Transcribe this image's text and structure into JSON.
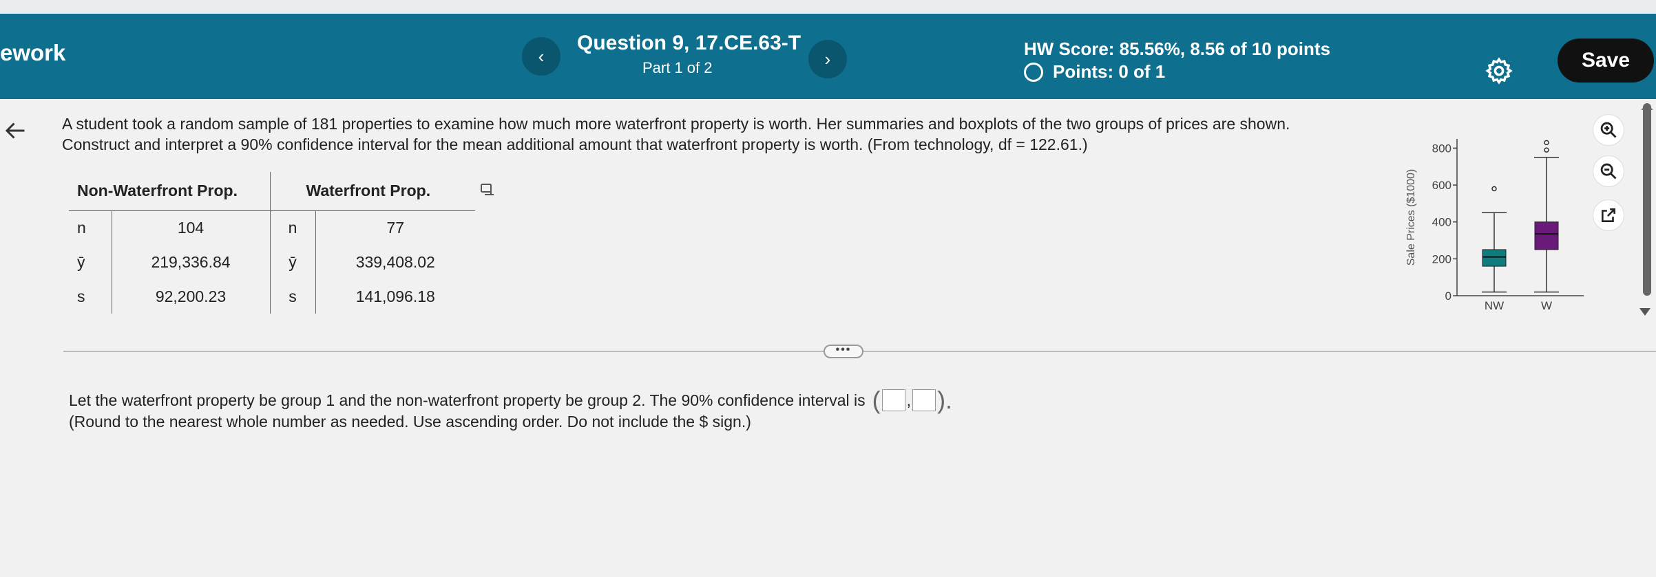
{
  "header": {
    "brand": "ework",
    "question_title": "Question 9, 17.CE.63-T",
    "part": "Part 1 of 2",
    "hw_score": "HW Score: 85.56%, 8.56 of 10 points",
    "points": "Points: 0 of 1",
    "save_label": "Save",
    "prev_label": "‹",
    "next_label": "›"
  },
  "question": {
    "line1": "A student took a random sample of 181 properties to examine how much more waterfront property is worth. Her summaries and boxplots of the two groups of prices are shown.",
    "line2": "Construct and interpret a 90% confidence interval for the mean additional amount that waterfront property is worth. (From technology, df = 122.61.)"
  },
  "table": {
    "header_nw": "Non-Waterfront Prop.",
    "header_w": "Waterfront Prop.",
    "rows": [
      {
        "sym": "n",
        "nw": "104",
        "w": "77"
      },
      {
        "sym": "ȳ",
        "nw": "219,336.84",
        "w": "339,408.02"
      },
      {
        "sym": "s",
        "nw": "92,200.23",
        "w": "141,096.18"
      }
    ]
  },
  "chart_data": {
    "type": "boxplot",
    "ylabel": "Sale Prices ($1000)",
    "categories": [
      "NW",
      "W"
    ],
    "yticks": [
      0,
      200,
      400,
      600,
      800
    ],
    "ylim": [
      0,
      850
    ],
    "colors": {
      "NW": "#0f7d7d",
      "W": "#6a1b7a"
    },
    "boxes": [
      {
        "name": "NW",
        "min": 20,
        "q1": 160,
        "median": 210,
        "q3": 250,
        "max": 450,
        "outliers": [
          580
        ]
      },
      {
        "name": "W",
        "min": 20,
        "q1": 250,
        "median": 335,
        "q3": 400,
        "max": 750,
        "outliers": [
          790,
          830
        ]
      }
    ]
  },
  "more_label": "•••",
  "answer": {
    "prompt": "Let the waterfront property be group 1 and the non-waterfront property be group 2. The 90% confidence interval is",
    "open_paren": "(",
    "comma": ",",
    "close_paren": ").",
    "hint": "(Round to the nearest whole number as needed. Use ascending order. Do not include the $ sign.)"
  }
}
